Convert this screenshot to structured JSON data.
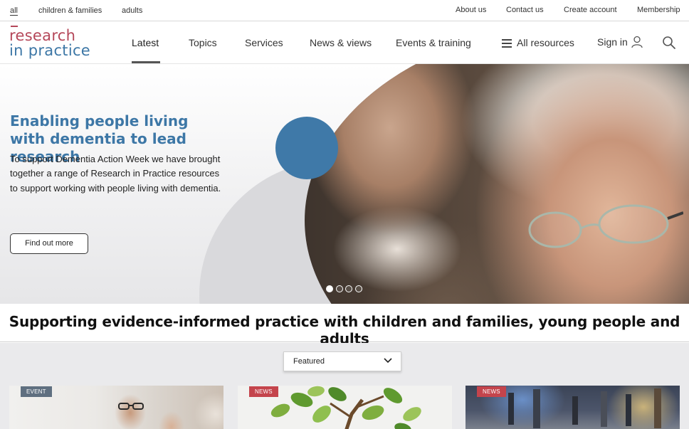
{
  "audience": {
    "items": [
      {
        "label": "all",
        "active": true
      },
      {
        "label": "children & families",
        "active": false
      },
      {
        "label": "adults",
        "active": false
      }
    ]
  },
  "utility_links": [
    "About us",
    "Contact us",
    "Create account",
    "Membership"
  ],
  "logo": {
    "line1": "research",
    "line2": "in practice"
  },
  "nav": {
    "items": [
      "Latest",
      "Topics",
      "Services",
      "News & views",
      "Events & training"
    ],
    "active": "Latest",
    "all_resources": "All resources",
    "sign_in": "Sign in"
  },
  "hero": {
    "title": "Enabling people living with dementia to lead research",
    "body": "To support Dementia Action Week we have brought together a range of Research in Practice resources to support working with people living with dementia.",
    "button": "Find out more",
    "slides": 4,
    "active_slide": 1
  },
  "tagline": "Supporting evidence-informed practice with children and families, young people and adults",
  "filter": {
    "selected": "Featured"
  },
  "cards": [
    {
      "badge": "EVENT",
      "type": "event"
    },
    {
      "badge": "NEWS",
      "type": "news"
    },
    {
      "badge": "NEWS",
      "type": "news"
    }
  ],
  "colors": {
    "brand_red": "#b5485a",
    "brand_blue": "#3d77a6",
    "news_badge": "#c4444c",
    "event_badge": "#5f6f80"
  }
}
